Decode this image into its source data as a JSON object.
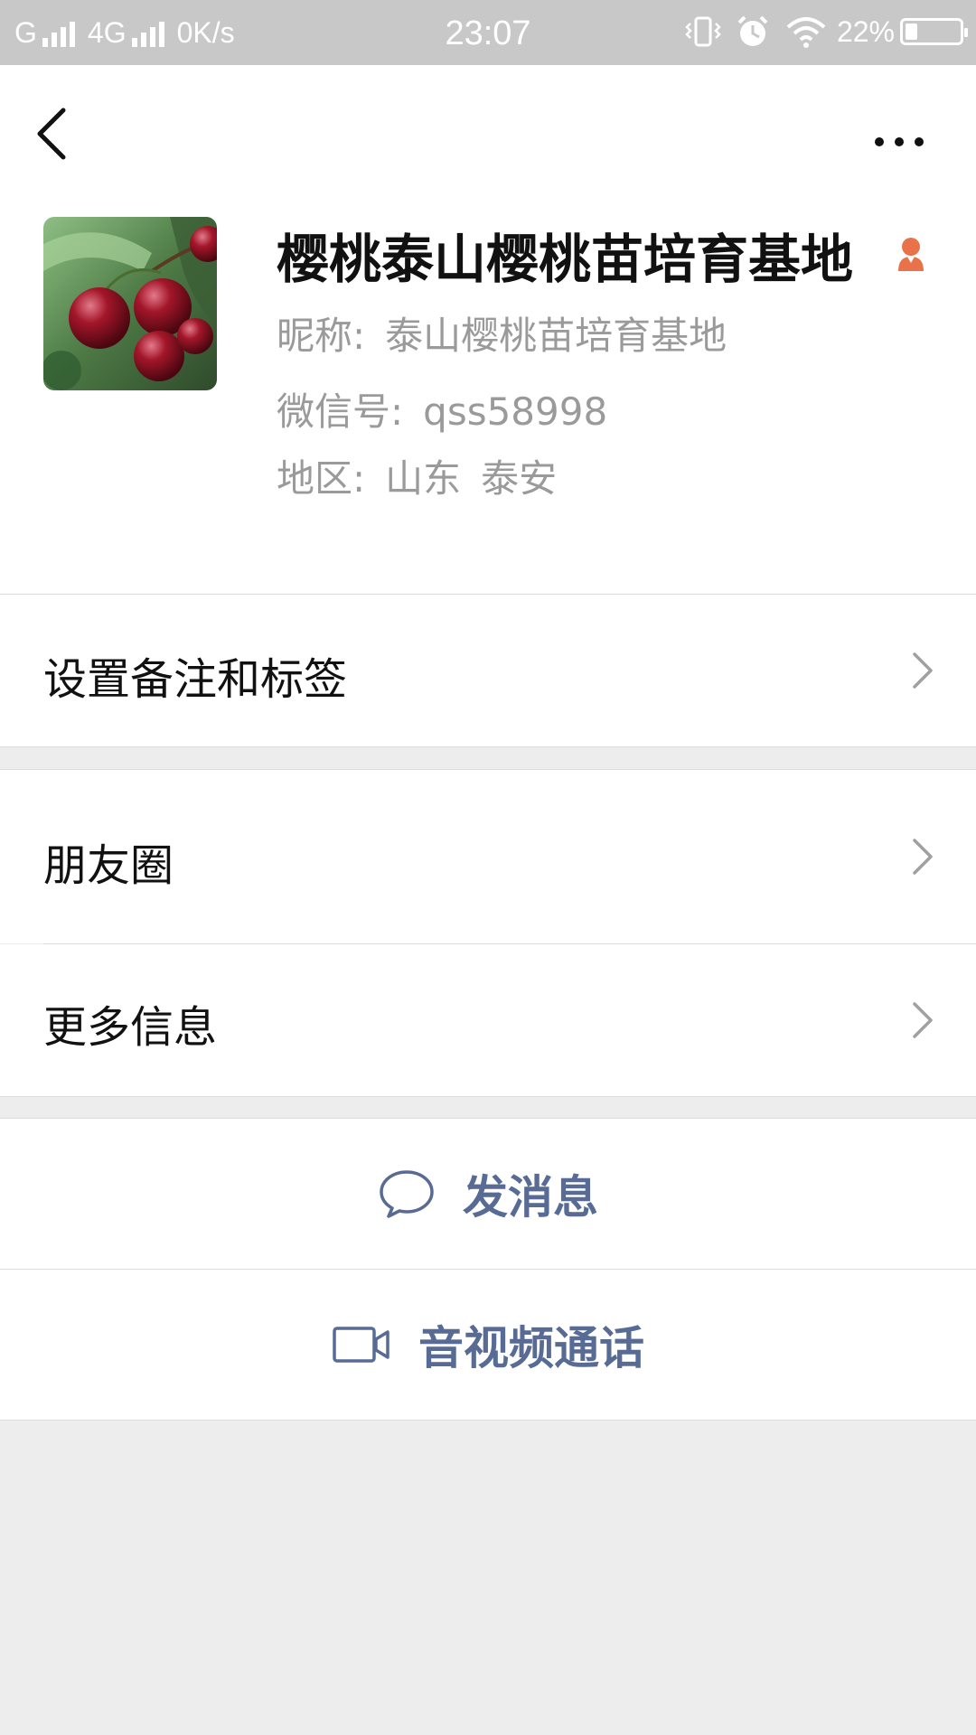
{
  "status_bar": {
    "carrier1": "G",
    "carrier2": "4G",
    "speed": "0K/s",
    "time": "23:07",
    "battery": "22%",
    "battery_level": 0.22,
    "icons": [
      "vibrate-icon",
      "alarm-icon",
      "wifi-icon",
      "battery-icon"
    ]
  },
  "header": {
    "back_icon": "chevron-left-icon",
    "more_icon": "more-dots-icon"
  },
  "profile": {
    "name": "樱桃泰山樱桃苗培育基地",
    "gender_icon": "female-icon",
    "nickname_label": "昵称:",
    "nickname": "泰山樱桃苗培育基地",
    "wechat_id_label": "微信号:",
    "wechat_id": "qss58998",
    "region_label": "地区:",
    "province": "山东",
    "city": "泰安"
  },
  "menu": {
    "remark_tags": "设置备注和标签",
    "moments": "朋友圈",
    "more_info": "更多信息"
  },
  "actions": {
    "send_message": "发消息",
    "video_call": "音视频通话"
  },
  "colors": {
    "accent": "#576b95",
    "background": "#ededed",
    "gender": "#e8734a"
  }
}
